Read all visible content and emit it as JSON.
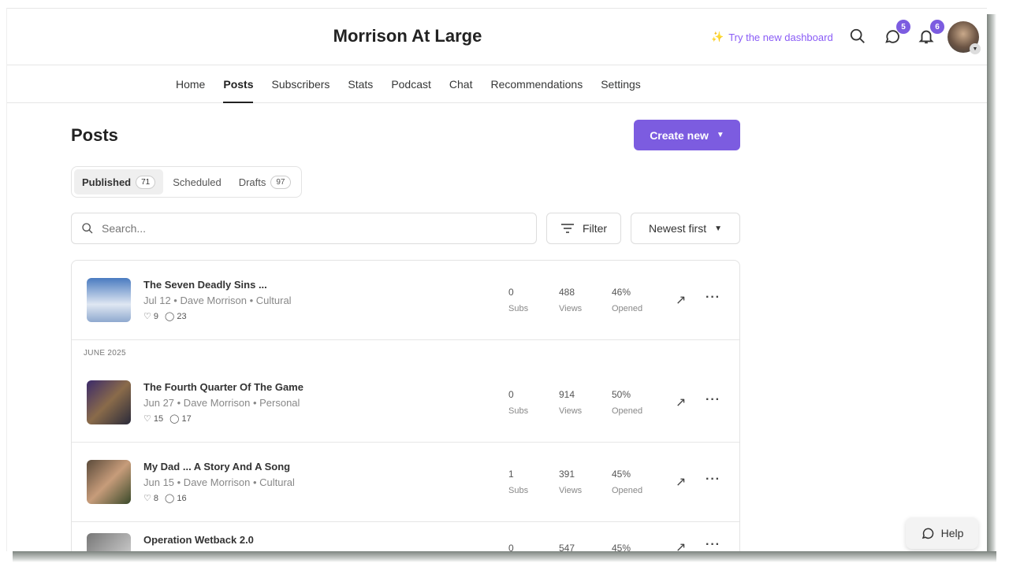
{
  "header": {
    "title": "Morrison At Large",
    "try_dashboard": "Try the new dashboard",
    "chat_badge": "5",
    "notif_badge": "6"
  },
  "nav": [
    "Home",
    "Posts",
    "Subscribers",
    "Stats",
    "Podcast",
    "Chat",
    "Recommendations",
    "Settings"
  ],
  "page": {
    "title": "Posts",
    "create_label": "Create new"
  },
  "tabs": [
    {
      "label": "Published",
      "count": "71"
    },
    {
      "label": "Scheduled"
    },
    {
      "label": "Drafts",
      "count": "97"
    }
  ],
  "search": {
    "placeholder": "Search..."
  },
  "filter_label": "Filter",
  "sort_label": "Newest first",
  "section_label": "JUNE 2025",
  "stat_labels": {
    "subs": "Subs",
    "views": "Views",
    "opened": "Opened"
  },
  "posts": [
    {
      "title": "The Seven Deadly Sins ...",
      "meta": "Jul 12 • Dave Morrison • Cultural",
      "likes": "9",
      "comments": "23",
      "subs": "0",
      "views": "488",
      "opened": "46%"
    },
    {
      "title": "The Fourth Quarter Of The Game",
      "meta": "Jun 27 • Dave Morrison • Personal",
      "likes": "15",
      "comments": "17",
      "subs": "0",
      "views": "914",
      "opened": "50%"
    },
    {
      "title": "My Dad ... A Story And A Song",
      "meta": "Jun 15 • Dave Morrison • Cultural",
      "likes": "8",
      "comments": "16",
      "subs": "1",
      "views": "391",
      "opened": "45%"
    },
    {
      "title": "Operation Wetback 2.0",
      "subs": "0",
      "views": "547",
      "opened": "45%"
    }
  ],
  "help_label": "Help",
  "colors": {
    "accent": "#7c5ce0"
  }
}
